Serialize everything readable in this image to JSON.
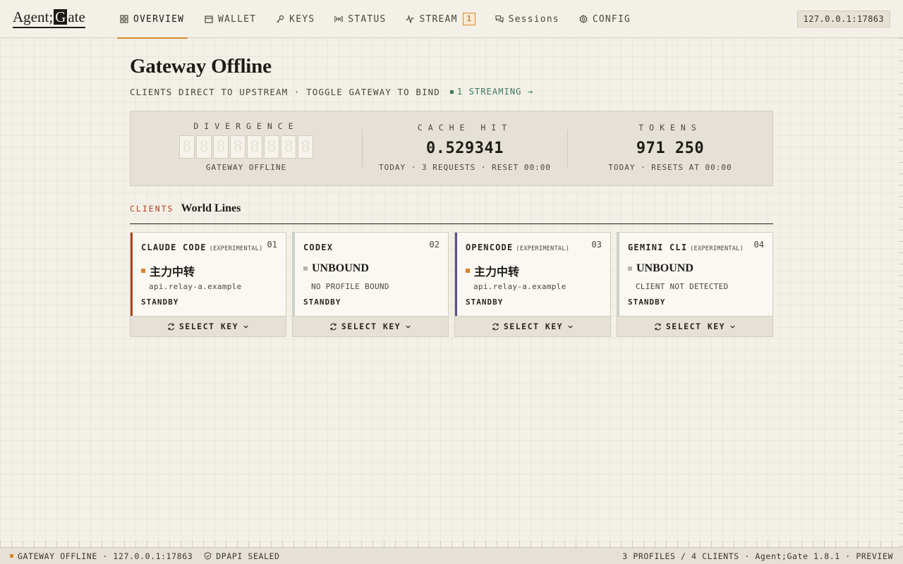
{
  "app": {
    "logo_left": "Agent;",
    "logo_boxed": "G",
    "logo_right": "ate",
    "address": "127.0.0.1:17863"
  },
  "nav": [
    {
      "label": "OVERVIEW",
      "icon": "grid-icon",
      "active": true
    },
    {
      "label": "WALLET",
      "icon": "wallet-icon"
    },
    {
      "label": "KEYS",
      "icon": "key-icon"
    },
    {
      "label": "STATUS",
      "icon": "broadcast-icon"
    },
    {
      "label": "STREAM",
      "icon": "pulse-icon",
      "badge": "1"
    },
    {
      "label": "Sessions",
      "icon": "chat-icon"
    },
    {
      "label": "CONFIG",
      "icon": "gear-icon"
    }
  ],
  "header": {
    "title": "Gateway Offline",
    "subtitle": "CLIENTS DIRECT TO UPSTREAM · TOGGLE GATEWAY TO BIND",
    "streaming": "1 STREAMING →"
  },
  "stats": {
    "divergence": {
      "label": "DIVERGENCE",
      "digits": [
        "8",
        "8",
        "8",
        "8",
        "8",
        "8",
        "8",
        "8"
      ],
      "caption": "GATEWAY OFFLINE"
    },
    "cache_hit": {
      "label": "CACHE HIT",
      "value": "0.529341",
      "caption": "TODAY · 3 REQUESTS · RESET 00:00"
    },
    "tokens": {
      "label": "TOKENS",
      "value": "971 250",
      "caption": "TODAY · RESETS AT 00:00"
    }
  },
  "clients_section": {
    "kicker": "CLIENTS",
    "title": "World Lines"
  },
  "clients": [
    {
      "name": "CLAUDE CODE",
      "exp": "(EXPERIMENTAL)",
      "num": "01",
      "status": "主力中转",
      "sub": "api.relay-a.example",
      "state": "STANDBY",
      "button": "SELECT KEY",
      "accent": "#b4441c",
      "dot": "#d9822b"
    },
    {
      "name": "CODEX",
      "exp": "",
      "num": "02",
      "status": "UNBOUND",
      "sub": "NO PROFILE BOUND",
      "state": "STANDBY",
      "button": "SELECT KEY",
      "accent": "#c9d2cf",
      "dot": "#b8b4aa"
    },
    {
      "name": "OPENCODE",
      "exp": "(EXPERIMENTAL)",
      "num": "03",
      "status": "主力中转",
      "sub": "api.relay-a.example",
      "state": "STANDBY",
      "button": "SELECT KEY",
      "accent": "#5b4f8a",
      "dot": "#d9822b"
    },
    {
      "name": "GEMINI CLI",
      "exp": "(EXPERIMENTAL)",
      "num": "04",
      "status": "UNBOUND",
      "sub": "CLIENT NOT DETECTED",
      "state": "STANDBY",
      "button": "SELECT KEY",
      "accent": "#c9d2cf",
      "dot": "#b8b4aa"
    }
  ],
  "statusbar": {
    "left_status": "GATEWAY OFFLINE · 127.0.0.1:17863",
    "seal": "DPAPI SEALED",
    "right": "3 PROFILES / 4 CLIENTS · Agent;Gate 1.8.1 · PREVIEW"
  }
}
